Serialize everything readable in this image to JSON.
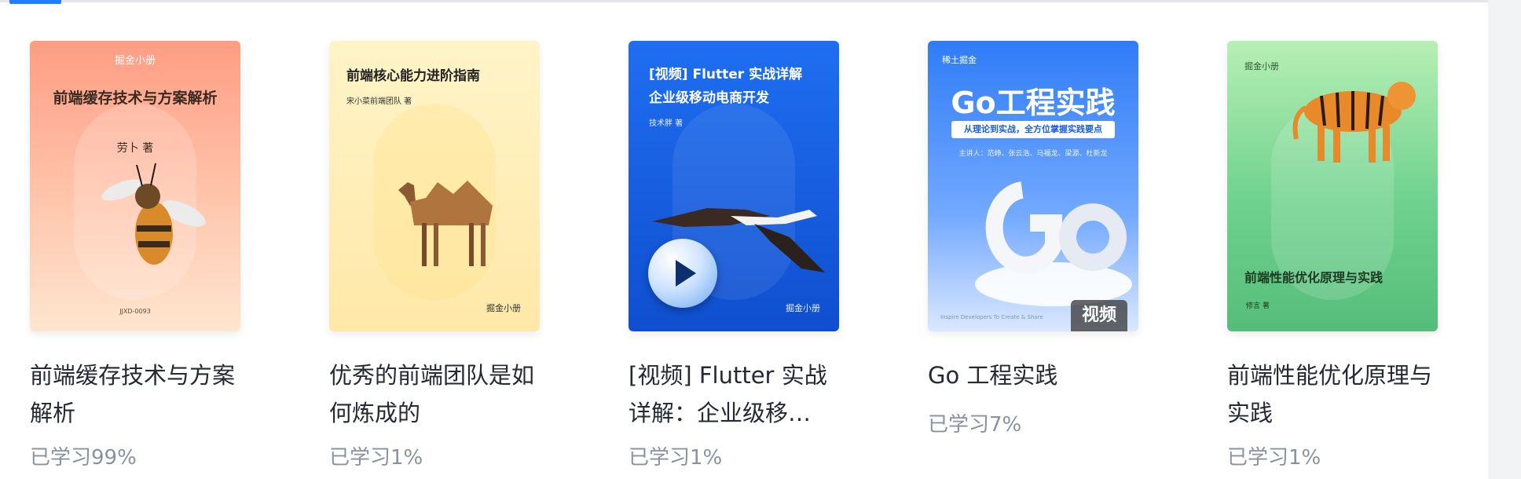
{
  "books": [
    {
      "title": "前端缓存技术与方案解析",
      "progress": "已学习99%",
      "cover": {
        "brand": "掘金小册",
        "heading": "前端缓存技术与方案解析",
        "author": "劳卜 著",
        "code": "JJXD-0093"
      }
    },
    {
      "title": "优秀的前端团队是如何炼成的",
      "progress": "已学习1%",
      "cover": {
        "heading": "前端核心能力进阶指南",
        "author": "宋小菜前端团队 著",
        "brand": "掘金小册"
      }
    },
    {
      "title": "[视频] Flutter 实战详解：企业级移…",
      "progress": "已学习1%",
      "cover": {
        "heading_line1": "[视频] Flutter 实战详解",
        "heading_line2": "企业级移动电商开发",
        "author": "技术胖 著",
        "brand": "掘金小册"
      }
    },
    {
      "title": "Go 工程实践",
      "progress": "已学习7%",
      "cover": {
        "brand": "稀土掘金",
        "heading": "Go工程实践",
        "subtitle": "从理论到实战，全方位掌握实践要点",
        "speakers": "主讲人：范峥、张云浩、马福龙、梁源、杜新龙",
        "tag": "视频",
        "footer": "Inspire Developers To Create & Share"
      }
    },
    {
      "title": "前端性能优化原理与实践",
      "progress": "已学习1%",
      "cover": {
        "brand": "掘金小册",
        "heading": "前端性能优化原理与实践",
        "author": "修言 著"
      }
    }
  ],
  "colors": {
    "accent": "#1e80ff",
    "title": "#252933",
    "progress": "#8a919f"
  }
}
